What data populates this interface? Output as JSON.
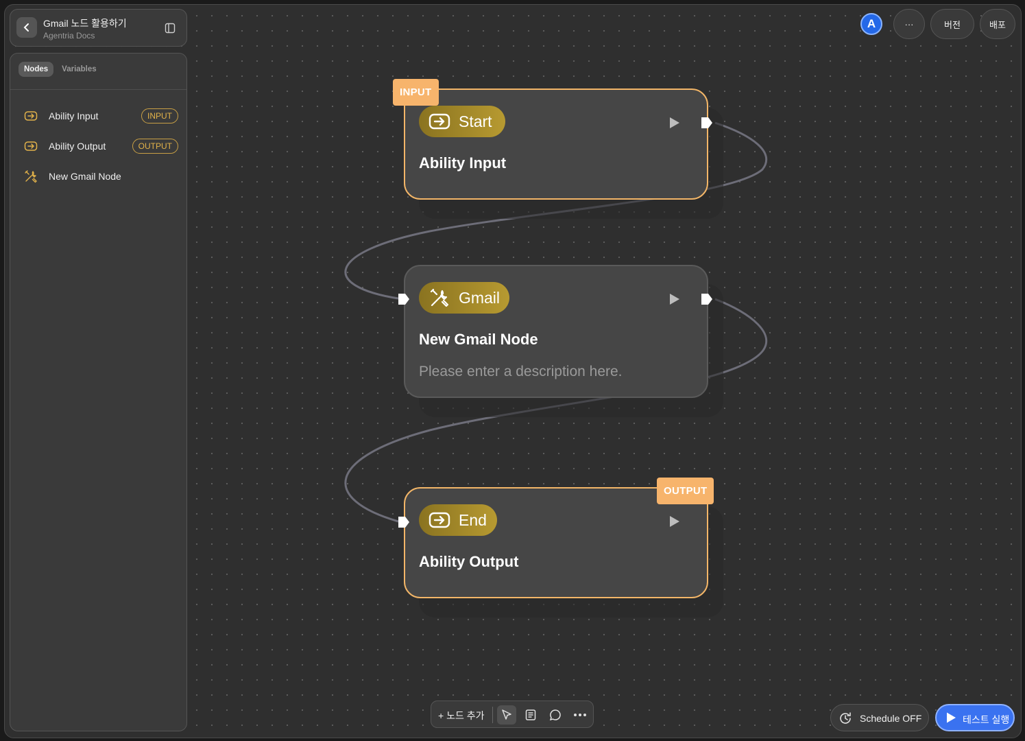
{
  "header": {
    "title": "Gmail 노드 활용하기",
    "subtitle": "Agentria Docs"
  },
  "side_panel": {
    "tabs": [
      {
        "label": "Nodes",
        "active": true
      },
      {
        "label": "Variables",
        "active": false
      }
    ],
    "items": [
      {
        "label": "Ability Input",
        "badge": "INPUT",
        "icon": "input-arrow-icon"
      },
      {
        "label": "Ability Output",
        "badge": "OUTPUT",
        "icon": "input-arrow-icon"
      },
      {
        "label": "New Gmail Node",
        "badge": "",
        "icon": "tools-icon"
      }
    ]
  },
  "topbar": {
    "avatar_letter": "A",
    "more_label": "···",
    "version_label": "버전",
    "deploy_label": "배포"
  },
  "nodes": {
    "start": {
      "tag": "INPUT",
      "pill": "Start",
      "title": "Ability Input"
    },
    "gmail": {
      "pill": "Gmail",
      "title": "New Gmail Node",
      "description": "Please enter a description here."
    },
    "end": {
      "tag": "OUTPUT",
      "pill": "End",
      "title": "Ability Output"
    }
  },
  "toolbar": {
    "add_node_label": "+ 노드 추가"
  },
  "footer": {
    "schedule_label": "Schedule OFF",
    "test_run_label": "테스트 실행"
  },
  "colors": {
    "accent_orange": "#f3b668",
    "pill_gold": "#b79a31",
    "primary_blue": "#3a72f0",
    "canvas_bg": "#2f2f2f"
  }
}
